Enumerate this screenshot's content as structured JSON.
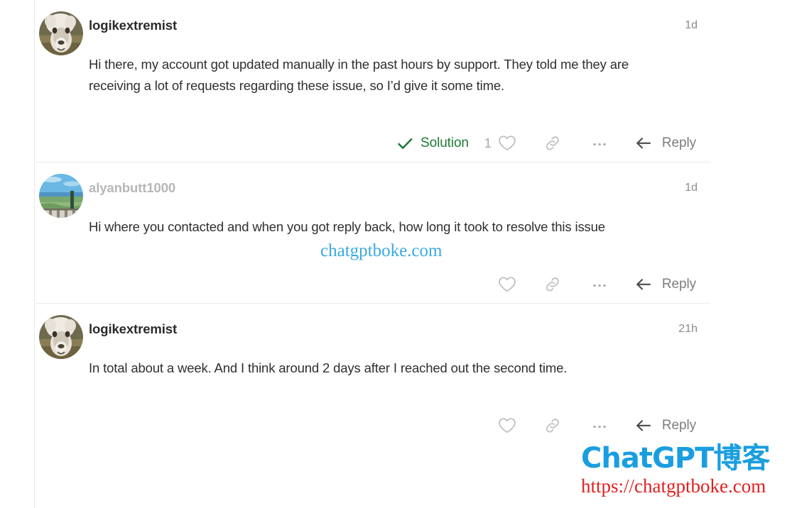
{
  "thread": {
    "posts": [
      {
        "username": "logikextremist",
        "username_muted": false,
        "timestamp": "1d",
        "avatar": "alpaca-photo",
        "body": "Hi there, my account got updated manually in the past hours by support. They told me they are receiving a lot of requests regarding these issue, so I’d give it some time.",
        "actions": {
          "solution_label": "Solution",
          "has_solution": true,
          "like_count": "1",
          "reply_label": "Reply"
        }
      },
      {
        "username": "alyanbutt1000",
        "username_muted": true,
        "timestamp": "1d",
        "avatar": "seaside-photo",
        "body": "Hi where you contacted and when you got reply back, how long it took to resolve this issue",
        "actions": {
          "solution_label": "",
          "has_solution": false,
          "like_count": "",
          "reply_label": "Reply"
        }
      },
      {
        "username": "logikextremist",
        "username_muted": false,
        "timestamp": "21h",
        "avatar": "alpaca-photo",
        "body": "In total about a week. And I think around 2 days after I reached out the second time.",
        "actions": {
          "solution_label": "",
          "has_solution": false,
          "like_count": "",
          "reply_label": "Reply"
        }
      }
    ]
  },
  "watermarks": {
    "inline_text": "chatgptboke.com",
    "logo_brand_en": "ChatGPT",
    "logo_brand_cn": "博客",
    "logo_url": "https://chatgptboke.com"
  },
  "colors": {
    "solution_green": "#1e7b34",
    "watermark_blue": "#1a9ee0",
    "watermark_red": "#e02020",
    "text": "#2f2f2f",
    "muted": "#9b9b9b"
  }
}
